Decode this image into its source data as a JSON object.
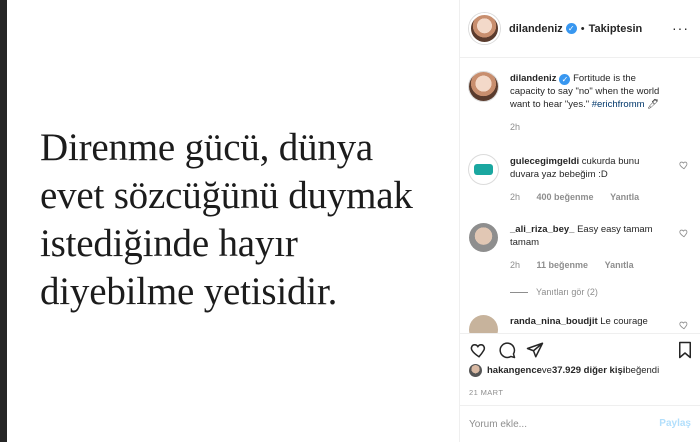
{
  "post": {
    "quote_lines": [
      "Direnme gücü, dünya",
      "evet sözcüğünü duymak",
      "istediğinde hayır",
      "diyebilme yetisidir."
    ]
  },
  "header": {
    "username": "dilandeniz",
    "verified_glyph": "✓",
    "separator": "•",
    "follow_status": "Takiptesin",
    "more_glyph": "···"
  },
  "caption": {
    "username": "dilandeniz",
    "verified_glyph": "✓",
    "text": "Fortitude is the capacity to say \"no\" when the world want to hear \"yes.\"",
    "hashtag": "#erichfromm",
    "emoji": "🖊",
    "time": "2h"
  },
  "comments": [
    {
      "username": "gulecegimgeldi",
      "text": "cukurda bunu duvara yaz bebeğim :D",
      "time": "2h",
      "likes": "400 beğenme",
      "reply": "Yanıtla"
    },
    {
      "username": "_ali_riza_bey_",
      "text": "Easy easy tamam tamam",
      "time": "2h",
      "likes": "11 beğenme",
      "reply": "Yanıtla"
    },
    {
      "username": "randa_nina_boudjit",
      "text": "Le courage"
    }
  ],
  "view_replies": "Yanıtları gör (2)",
  "likes_line": {
    "user": "hakangence",
    "middle": " ve ",
    "others": "37.929 diğer kişi",
    "suffix": " beğendi"
  },
  "date": "21 MART",
  "comment_box": {
    "placeholder": "Yorum ekle...",
    "post_label": "Paylaş"
  },
  "icons": [
    "heart-icon",
    "comment-icon",
    "share-icon",
    "bookmark-icon",
    "more-icon"
  ]
}
